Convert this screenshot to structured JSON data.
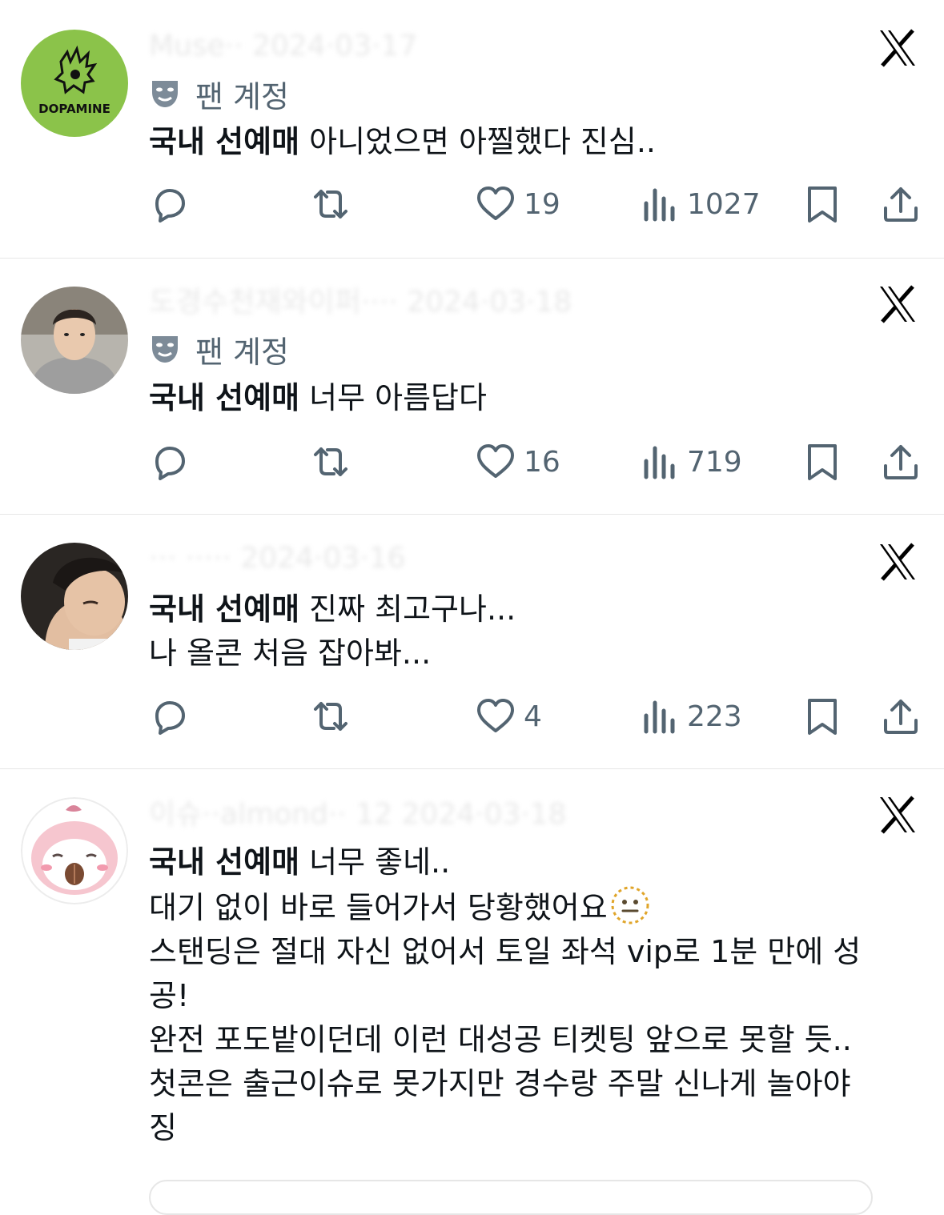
{
  "tweets": [
    {
      "handle_blurred": "Muse·· 2024·03·17",
      "fan_label": "팬 계정",
      "bold": "국내 선예매",
      "lines": [
        " 아니었으면 아찔했다 진심.."
      ],
      "replies": "",
      "reposts": "",
      "likes": "19",
      "views": "1027"
    },
    {
      "handle_blurred": "도경수천재와이퍼····  2024·03·18",
      "fan_label": "팬 계정",
      "bold": "국내 선예매",
      "lines": [
        " 너무 아름답다"
      ],
      "likes": "16",
      "views": "719"
    },
    {
      "handle_blurred": "··· ·····  2024·03·16",
      "bold": "국내 선예매",
      "lines": [
        " 진짜 최고구나...",
        "나 올콘 처음 잡아봐..."
      ],
      "likes": "4",
      "views": "223"
    },
    {
      "handle_blurred": "이슈··almond·· 12 2024·03·18",
      "bold": "국내 선예매",
      "lines": [
        " 너무 좋네..",
        "대기 없이 바로 들어가서 당황했어요",
        "스탠딩은 절대 자신 없어서 토일 좌석 vip로 1분 만에 성",
        "공!",
        "완전 포도밭이던데 이런 대성공 티켓팅 앞으로 못할 듯..",
        "첫콘은 출근이슈로 못가지만 경수랑 주말 신나게 놀아야",
        "징"
      ]
    }
  ],
  "icons": {
    "reply": "reply-icon",
    "repost": "repost-icon",
    "like": "heart-icon",
    "views": "views-icon",
    "bookmark": "bookmark-icon",
    "share": "share-icon",
    "x": "x-logo-icon",
    "fan": "fan-account-mask-icon",
    "emoji": "dotted-line-face-emoji"
  },
  "colors": {
    "text": "#0f1419",
    "secondary": "#536471",
    "divider": "#e6e6e6",
    "avatar1": "#8bc34a"
  }
}
